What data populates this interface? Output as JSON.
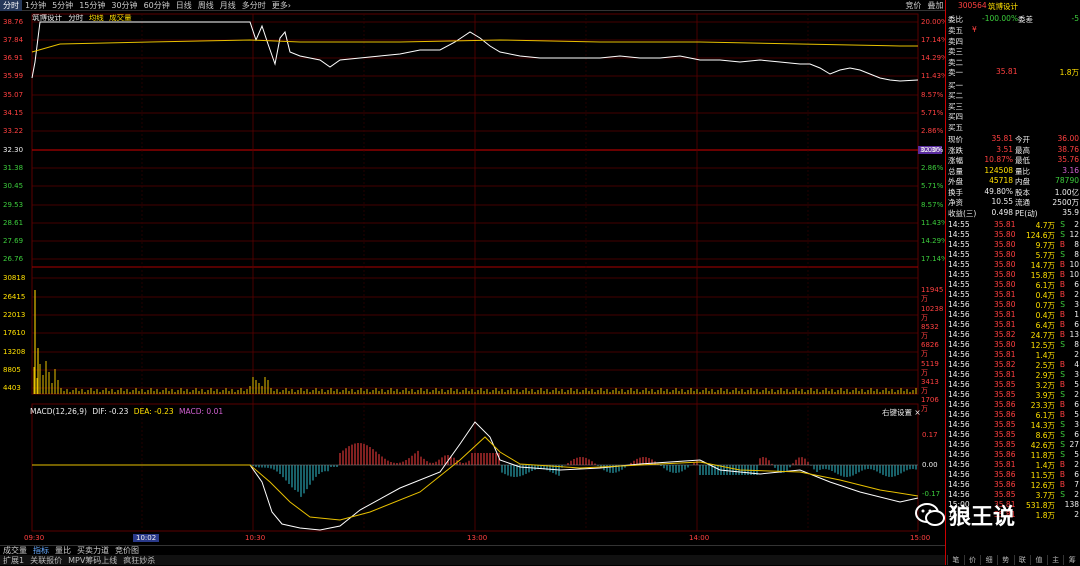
{
  "topbar": {
    "tabs": [
      "分时",
      "1分钟",
      "5分钟",
      "15分钟",
      "30分钟",
      "60分钟",
      "日线",
      "周线",
      "月线",
      "多分时",
      "更多›"
    ],
    "active": 0,
    "right": [
      "竞价",
      "叠加",
      "统计",
      "画线",
      "F10",
      "标记",
      "-自选",
      "返回"
    ]
  },
  "chart": {
    "stock_name": "筑博设计",
    "legend": [
      "分时",
      "均线",
      "成交量"
    ],
    "price_ticks_up": [
      "38.76",
      "37.84",
      "36.91",
      "35.99",
      "35.07",
      "34.15",
      "33.22"
    ],
    "price_mid": "32.30",
    "price_ticks_down": [
      "31.38",
      "30.45",
      "29.53",
      "28.61",
      "27.69",
      "26.76"
    ],
    "pct_up": [
      "20.00%",
      "17.14%",
      "14.29%",
      "11.43%",
      "8.57%",
      "5.71%",
      "2.86%"
    ],
    "pct_mid": "0.00%",
    "pct_down": [
      "2.86%",
      "5.71%",
      "8.57%",
      "11.43%",
      "14.29%",
      "17.14%"
    ],
    "cursor_price": "32.30",
    "vol_ticks": [
      "30818",
      "26415",
      "22013",
      "17610",
      "13208",
      "8805",
      "4403"
    ],
    "vol_right": [
      "11945万",
      "10238万",
      "8532万",
      "6826万",
      "5119万",
      "3413万",
      "1706万"
    ],
    "macd_label": "MACD(12,26,9)",
    "macd_dif": "DIF: -0.23",
    "macd_dea": "DEA: -0.23",
    "macd_val": "MACD: 0.01",
    "macd_setting": "右键设置 ×",
    "macd_ticks": [
      "0.17",
      "0.00",
      "-0.17"
    ],
    "time_labels": [
      "09:30",
      "10:30",
      "13:00",
      "14:00",
      "15:00"
    ],
    "cursor_time": "10:02",
    "colors": {
      "price": "#ffffff",
      "avg": "#e8c000",
      "up": "#ff4040",
      "down": "#30c0d0",
      "grid": "#5a0000"
    }
  },
  "panel": {
    "code": "300564",
    "name": "筑博设计",
    "ratio_label": "委比",
    "ratio_value": "-100.00%",
    "diff_label": "委差",
    "diff_value": "-5",
    "sell_levels": [
      {
        "label": "卖五",
        "price": "¥",
        "vol": ""
      },
      {
        "label": "卖四",
        "price": "",
        "vol": ""
      },
      {
        "label": "卖三",
        "price": "",
        "vol": ""
      },
      {
        "label": "卖二",
        "price": "",
        "vol": ""
      },
      {
        "label": "卖一",
        "price": "35.81",
        "vol": "1.8万"
      }
    ],
    "buy_levels": [
      "买一",
      "买二",
      "买三",
      "买四",
      "买五"
    ],
    "stats": [
      {
        "l1": "现价",
        "v1": "35.81",
        "l2": "今开",
        "v2": "36.00"
      },
      {
        "l1": "涨跌",
        "v1": "3.51",
        "l2": "最高",
        "v2": "38.76"
      },
      {
        "l1": "涨幅",
        "v1": "10.87%",
        "l2": "最低",
        "v2": "35.76"
      },
      {
        "l1": "总量",
        "v1": "124508",
        "l2": "量比",
        "v2": "3.16"
      },
      {
        "l1": "外盘",
        "v1": "45718",
        "l2": "内盘",
        "v2": "78790"
      },
      {
        "l1": "换手",
        "v1": "49.80%",
        "l2": "股本",
        "v2": "1.00亿"
      },
      {
        "l1": "净资",
        "v1": "10.55",
        "l2": "流通",
        "v2": "2500万"
      },
      {
        "l1": "收益(三)",
        "v1": "0.498",
        "l2": "PE(动)",
        "v2": "35.9"
      }
    ],
    "ticks": [
      {
        "t": "14:55",
        "p": "35.81",
        "v": "4.7万",
        "d": "S",
        "n": "2"
      },
      {
        "t": "14:55",
        "p": "35.80",
        "v": "124.6万",
        "d": "S",
        "n": "12"
      },
      {
        "t": "14:55",
        "p": "35.80",
        "v": "9.7万",
        "d": "B",
        "n": "8"
      },
      {
        "t": "14:55",
        "p": "35.80",
        "v": "5.7万",
        "d": "S",
        "n": "8"
      },
      {
        "t": "14:55",
        "p": "35.80",
        "v": "14.7万",
        "d": "B",
        "n": "10"
      },
      {
        "t": "14:55",
        "p": "35.80",
        "v": "15.8万",
        "d": "B",
        "n": "10"
      },
      {
        "t": "14:55",
        "p": "35.80",
        "v": "6.1万",
        "d": "B",
        "n": "6"
      },
      {
        "t": "14:55",
        "p": "35.81",
        "v": "0.4万",
        "d": "B",
        "n": "2"
      },
      {
        "t": "14:56",
        "p": "35.80",
        "v": "0.7万",
        "d": "S",
        "n": "3"
      },
      {
        "t": "14:56",
        "p": "35.81",
        "v": "0.4万",
        "d": "B",
        "n": "1"
      },
      {
        "t": "14:56",
        "p": "35.81",
        "v": "6.4万",
        "d": "B",
        "n": "6"
      },
      {
        "t": "14:56",
        "p": "35.82",
        "v": "24.7万",
        "d": "B",
        "n": "13"
      },
      {
        "t": "14:56",
        "p": "35.80",
        "v": "12.5万",
        "d": "S",
        "n": "8"
      },
      {
        "t": "14:56",
        "p": "35.81",
        "v": "1.4万",
        "d": "",
        "n": "2"
      },
      {
        "t": "14:56",
        "p": "35.82",
        "v": "2.5万",
        "d": "B",
        "n": "4"
      },
      {
        "t": "14:56",
        "p": "35.81",
        "v": "2.9万",
        "d": "S",
        "n": "3"
      },
      {
        "t": "14:56",
        "p": "35.85",
        "v": "3.2万",
        "d": "B",
        "n": "5"
      },
      {
        "t": "14:56",
        "p": "35.85",
        "v": "3.9万",
        "d": "S",
        "n": "2"
      },
      {
        "t": "14:56",
        "p": "35.86",
        "v": "23.3万",
        "d": "B",
        "n": "6"
      },
      {
        "t": "14:56",
        "p": "35.86",
        "v": "6.1万",
        "d": "B",
        "n": "5"
      },
      {
        "t": "14:56",
        "p": "35.85",
        "v": "14.3万",
        "d": "S",
        "n": "3"
      },
      {
        "t": "14:56",
        "p": "35.85",
        "v": "8.6万",
        "d": "S",
        "n": "6"
      },
      {
        "t": "14:56",
        "p": "35.85",
        "v": "42.6万",
        "d": "S",
        "n": "27"
      },
      {
        "t": "14:56",
        "p": "35.86",
        "v": "11.8万",
        "d": "S",
        "n": "5"
      },
      {
        "t": "14:56",
        "p": "35.81",
        "v": "1.4万",
        "d": "B",
        "n": "2"
      },
      {
        "t": "14:56",
        "p": "35.86",
        "v": "11.5万",
        "d": "B",
        "n": "6"
      },
      {
        "t": "14:56",
        "p": "35.86",
        "v": "12.6万",
        "d": "B",
        "n": "7"
      },
      {
        "t": "14:56",
        "p": "35.85",
        "v": "3.7万",
        "d": "S",
        "n": "2"
      },
      {
        "t": "15:00",
        "p": "35.81",
        "v": "531.8万",
        "d": "",
        "n": "138"
      },
      {
        "t": "15:19",
        "p": "35.81",
        "v": "1.8万",
        "d": "",
        "n": "2"
      }
    ],
    "bottom_tabs": [
      "笔",
      "价",
      "细",
      "势",
      "联",
      "值",
      "主",
      "筹"
    ]
  },
  "bottom_tabs": [
    "成交量",
    "指标",
    "量比",
    "买卖力道",
    "竞价图"
  ],
  "bottom_active": 1,
  "status": [
    "扩展1",
    "关联报价",
    "MPV筹码上线",
    "疯狂妙杀"
  ],
  "watermark": "狼王说"
}
